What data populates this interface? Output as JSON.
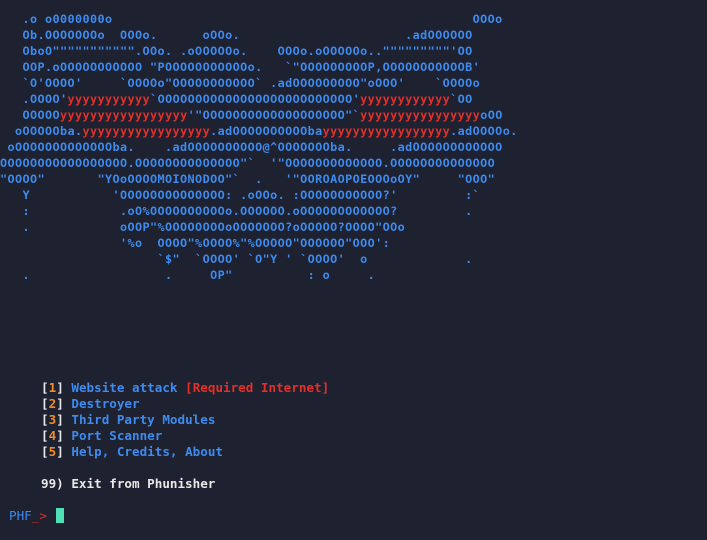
{
  "banner": {
    "lines": [
      [
        {
          "t": "   .o o0000000o                                                OOOo"
        }
      ],
      [
        {
          "t": "   Ob.OOOOOOOo  OOOo.      oOOo.                      .adOOOOOO"
        }
      ],
      [
        {
          "t": "   OboO\"\"\"\"\"\"\"\"\"\"\".OOo. .oOOOOOo.    OOOo.oOOOOOo..\"\"\"\"\"\"\"\"\"'OO"
        }
      ],
      [
        {
          "t": "   OOP.oOOOOOOOOOOO \"POOOOOOOOOOOo.   `\"OOOOOOOOOP,OOOOOOOOOOOB'"
        }
      ],
      [
        {
          "t": "   `O'OOOO'     `OOOOo\"OOOOOOOOOOO` .adOOOOOOOOO\"oOOO'    `OOOOo"
        }
      ],
      [
        {
          "t": "   .OOOO'"
        },
        {
          "t": "yyyyyyyyyyy",
          "r": true
        },
        {
          "t": "`OOOOOOOOOOOOOOOOOOOOOOOOOO'"
        },
        {
          "t": "yyyyyyyyyyyy",
          "r": true
        },
        {
          "t": "`OO"
        }
      ],
      [
        {
          "t": "   OOOOO"
        },
        {
          "t": "yyyyyyyyyyyyyyyyy",
          "r": true
        },
        {
          "t": "'\"OOOOOOOOOOOOOOOOOOO\"`"
        },
        {
          "t": "yyyyyyyyyyyyyyyy",
          "r": true
        },
        {
          "t": "oOO"
        }
      ],
      [
        {
          "t": "  oOOOOOba."
        },
        {
          "t": "yyyyyyyyyyyyyyyyy",
          "r": true
        },
        {
          "t": ".adOOOOOOOOOOba"
        },
        {
          "t": "yyyyyyyyyyyyyyyyy",
          "r": true
        },
        {
          "t": ".adOOOOo."
        }
      ],
      [
        {
          "t": " oOOOOOOOOOOOOOba.    .adOOOOOOOOOO@^OOOOOOOba.     .adOOOOOOOOOOOO"
        }
      ],
      [
        {
          "t": "OOOOOOOOOOOOOOOOO.OOOOOOOOOOOOOO\"`  '\"OOOOOOOOOOOOO.OOOOOOOOOOOOOO"
        }
      ],
      [
        {
          "t": "\"OOOO\"       \"YOoOOOOMOIONODOO\"`  .   '\"OOROAOPOEOOOoOY\"     \"OOO\""
        }
      ],
      [
        {
          "t": "   Y           'OOOOOOOOOOOOOO: .oOOo. :OOOOOOOOOOO?'         :`"
        }
      ],
      [
        {
          "t": "   :            .oO%OOOOOOOOOOo.OOOOOO.oOOOOOOOOOOOO?         ."
        }
      ],
      [
        {
          "t": "   .            oOOP\"%OOOOOOOOoOOOOOOO?oOOOOO?OOOO\"OOo"
        }
      ],
      [
        {
          "t": "                '%o  OOOO\"%OOOO%\"%OOOOO\"OOOOOO\"OOO':"
        }
      ],
      [
        {
          "t": "                     `$\"  `OOOO' `O\"Y ' `OOOO'  o             ."
        }
      ],
      [
        {
          "t": "   .                  .     OP\"          : o     ."
        }
      ]
    ]
  },
  "menu": {
    "items": [
      {
        "number": "1",
        "label": "Website attack",
        "note": "[Required Internet]"
      },
      {
        "number": "2",
        "label": "Destroyer",
        "note": ""
      },
      {
        "number": "3",
        "label": "Third Party Modules",
        "note": ""
      },
      {
        "number": "4",
        "label": "Port Scanner",
        "note": ""
      },
      {
        "number": "5",
        "label": "Help, Credits, About",
        "note": ""
      }
    ],
    "exit_label": "99) Exit from Phunisher"
  },
  "prompt": {
    "text": "PHF",
    "arrow": "_>"
  },
  "colors": {
    "background": "#1e2130",
    "art_blue": "#3d8bef",
    "art_red": "#e2302a",
    "number_orange": "#f08c2c",
    "cursor": "#4fe0b6"
  }
}
